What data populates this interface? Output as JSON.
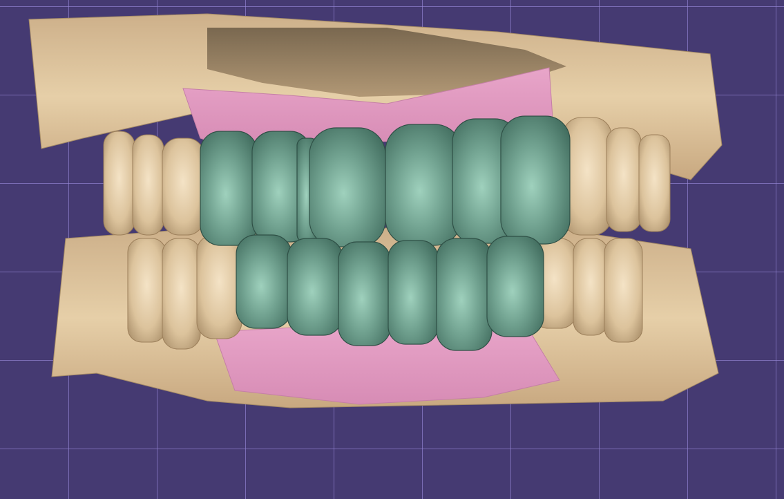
{
  "viewport": {
    "grid_color": "#9687d7",
    "background_color": "#453a72"
  },
  "model": {
    "scan_color": "#d9bd95",
    "gingiva_color": "#e9a3c8",
    "restoration_color": "#6f9c8c",
    "upper_restoration_teeth": 7,
    "lower_restoration_teeth": 6
  }
}
